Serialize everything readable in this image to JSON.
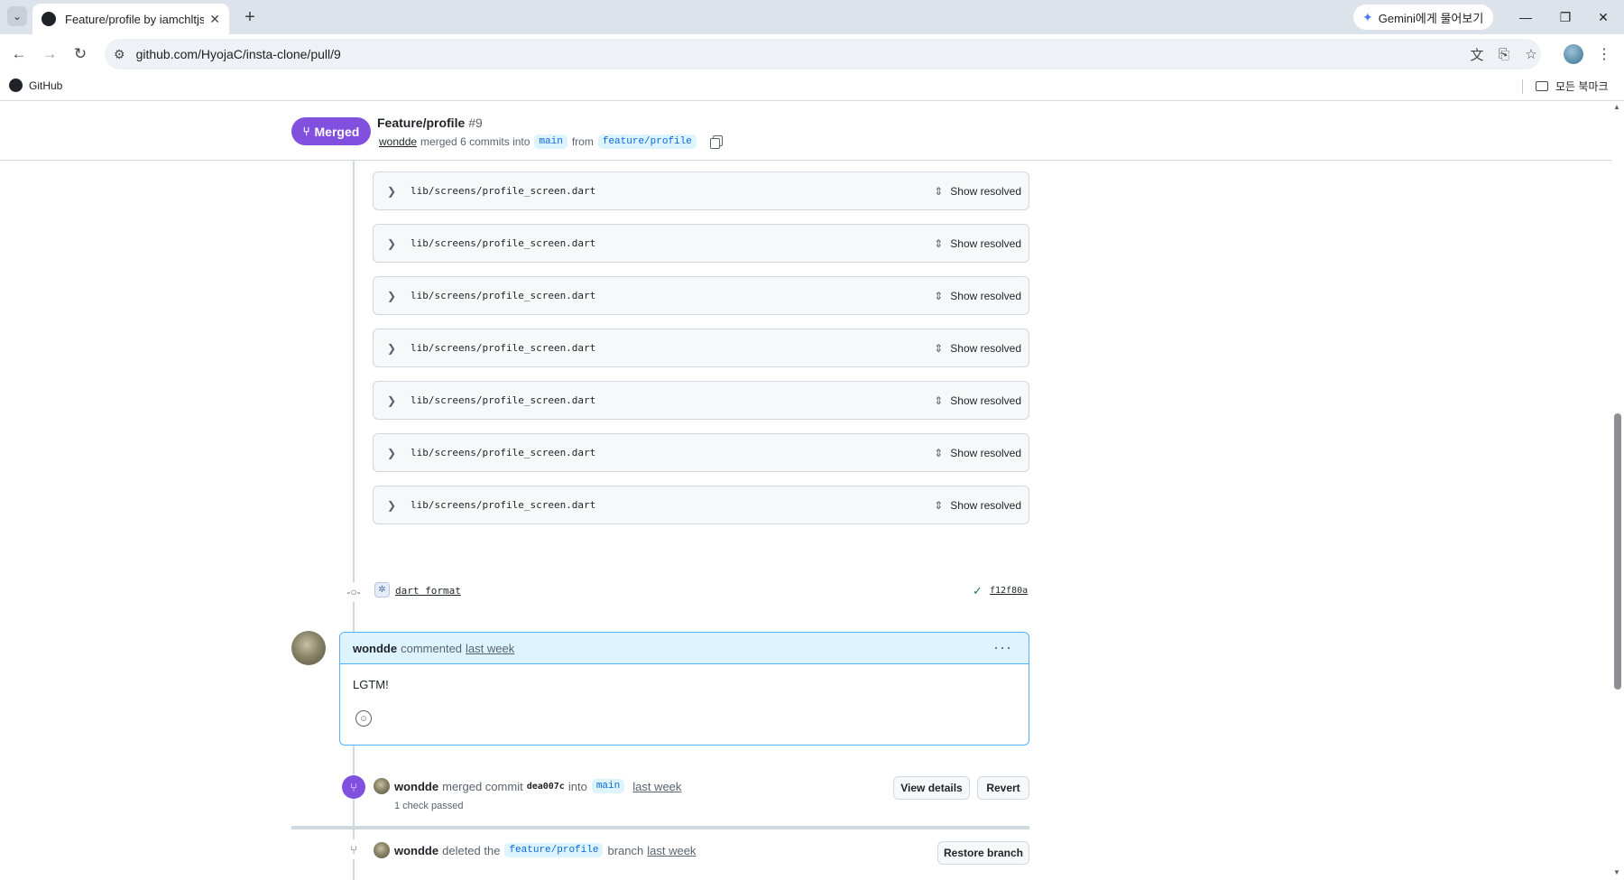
{
  "browser": {
    "tab_title": "Feature/profile by iamchltjsgh",
    "close_glyph": "✕",
    "new_tab_glyph": "+",
    "gemini_label": "Gemini에게 물어보기",
    "url": "github.com/HyojaC/insta-clone/pull/9",
    "bookmark_github": "GitHub",
    "bookmark_all": "모든 북마크",
    "icons": [
      "tab-list-icon",
      "github-favicon",
      "back-icon",
      "forward-icon",
      "reload-icon",
      "site-settings-icon",
      "translate-icon",
      "install-app-icon",
      "bookmark-star-icon",
      "profile-avatar",
      "menu-kebab-icon",
      "minimize-icon",
      "restore-icon",
      "close-window-icon"
    ]
  },
  "pr_header": {
    "state_label": "Merged",
    "title": "Feature/profile",
    "number": "#9",
    "author": "wondde",
    "merged_text": "merged 6 commits into",
    "base_branch": "main",
    "from_text": "from",
    "head_branch": "feature/profile"
  },
  "resolved_threads": {
    "file_path": "lib/screens/profile_screen.dart",
    "show_label": "Show resolved",
    "count": 8
  },
  "commit": {
    "message": "dart format",
    "sha": "f12f80a",
    "status": "success"
  },
  "comment": {
    "author": "wondde",
    "action": "commented",
    "time": "last week",
    "body": "LGTM!"
  },
  "merge_event": {
    "author": "wondde",
    "action": "merged commit",
    "sha": "dea007c",
    "into_text": "into",
    "branch": "main",
    "time": "last week",
    "checks": "1 check passed",
    "view_details_label": "View details",
    "revert_label": "Revert"
  },
  "delete_event": {
    "author": "wondde",
    "action": "deleted the",
    "branch": "feature/profile",
    "branch_suffix": "branch",
    "time": "last week",
    "restore_label": "Restore branch"
  },
  "colors": {
    "merged_purple": "#8250df",
    "link_blue": "#0969da",
    "comment_header_bg": "#ddf4ff",
    "success_green": "#1a7f37"
  }
}
